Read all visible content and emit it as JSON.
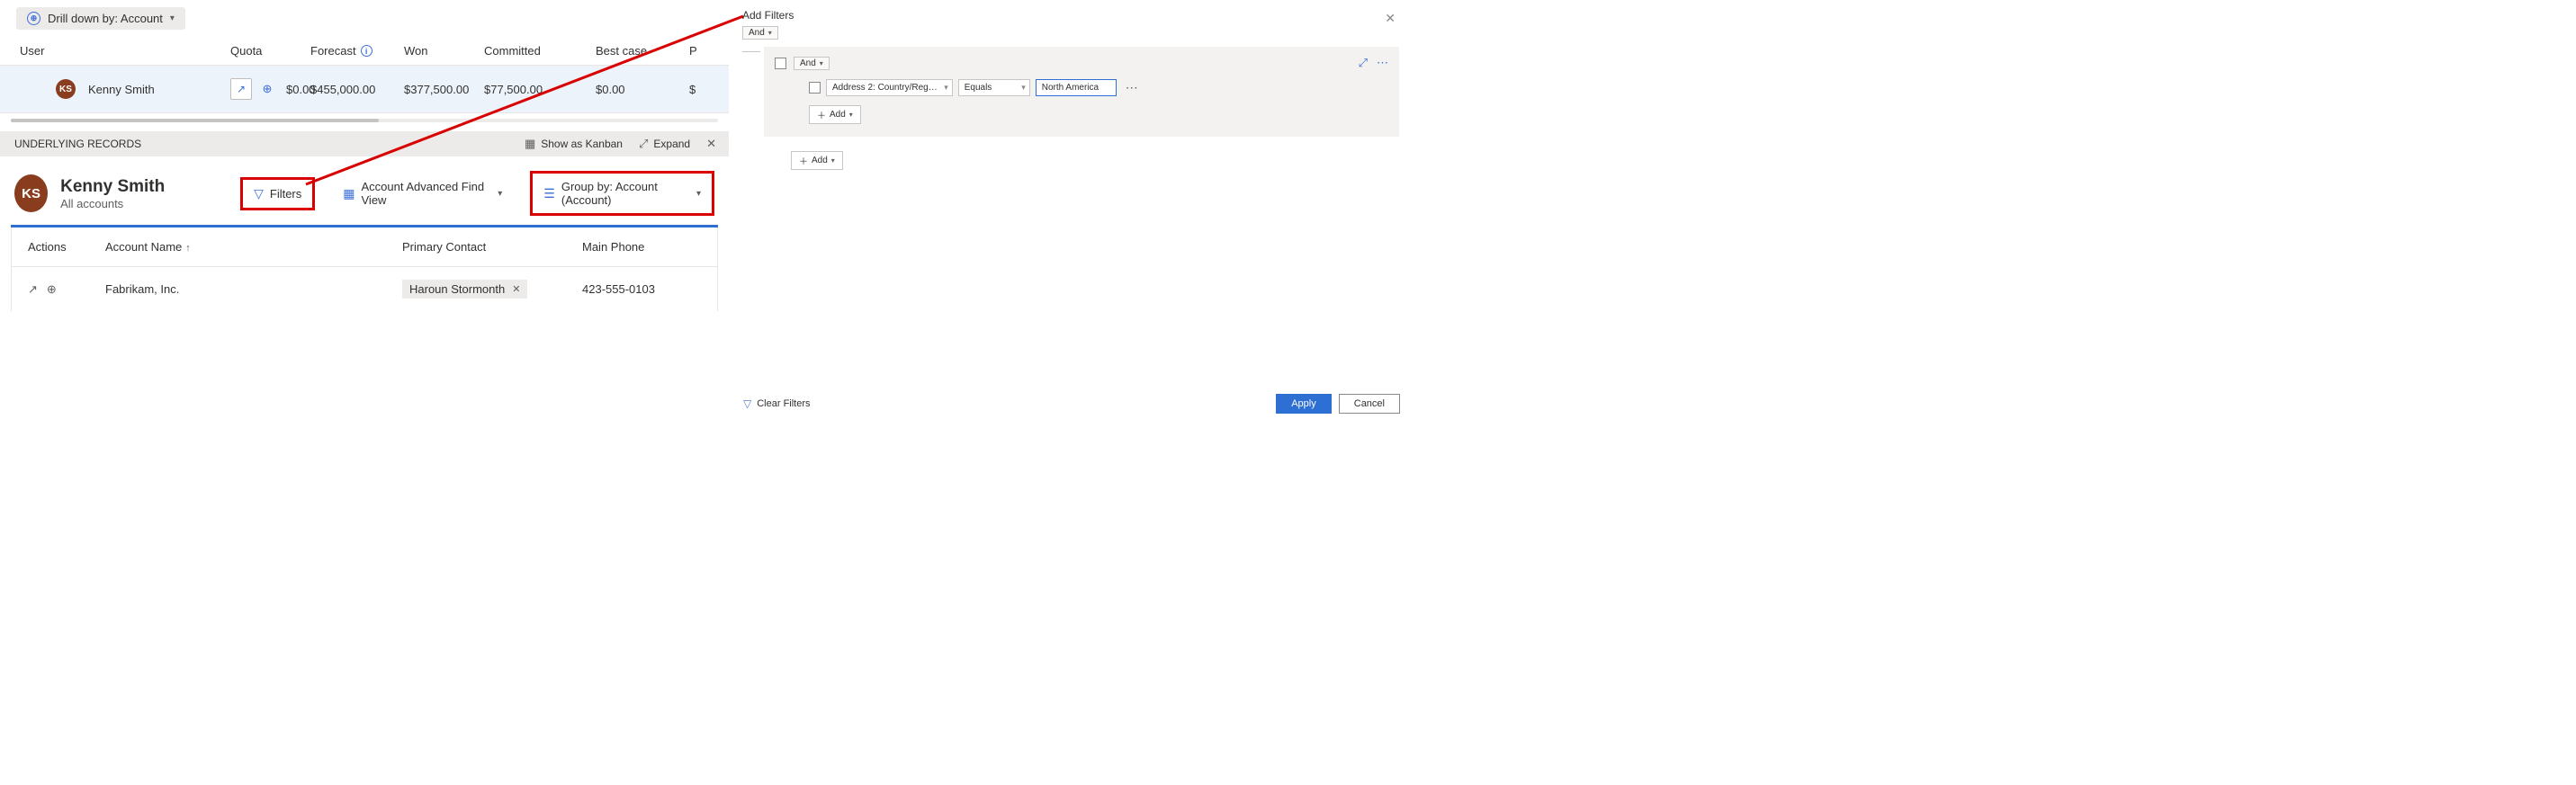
{
  "drilldown": {
    "label": "Drill down by: Account"
  },
  "forecast_grid": {
    "headers": {
      "user": "User",
      "quota": "Quota",
      "forecast": "Forecast",
      "won": "Won",
      "committed": "Committed",
      "best_case": "Best case",
      "pipeline_initial": "P"
    },
    "row": {
      "initials": "KS",
      "name": "Kenny Smith",
      "quota": "$0.00",
      "forecast": "$455,000.00",
      "won": "$377,500.00",
      "committed": "$77,500.00",
      "best_case": "$0.00",
      "pipeline": "$"
    }
  },
  "underlying": {
    "title": "UNDERLYING RECORDS",
    "kanban": "Show as Kanban",
    "expand": "Expand"
  },
  "detail": {
    "initials": "KS",
    "name": "Kenny Smith",
    "subtitle": "All accounts",
    "filters": "Filters",
    "view": "Account Advanced Find View",
    "group_by": "Group by:  Account (Account)"
  },
  "table": {
    "headers": {
      "actions": "Actions",
      "account_name": "Account Name",
      "primary_contact": "Primary Contact",
      "main_phone": "Main Phone"
    },
    "row": {
      "account": "Fabrikam, Inc.",
      "contact": "Haroun Stormonth",
      "phone": "423-555-0103"
    }
  },
  "filters_panel": {
    "title": "Add Filters",
    "and": "And",
    "field": "Address 2: Country/Reg…",
    "operator": "Equals",
    "value": "North America",
    "add": "Add",
    "clear": "Clear Filters",
    "apply": "Apply",
    "cancel": "Cancel"
  }
}
